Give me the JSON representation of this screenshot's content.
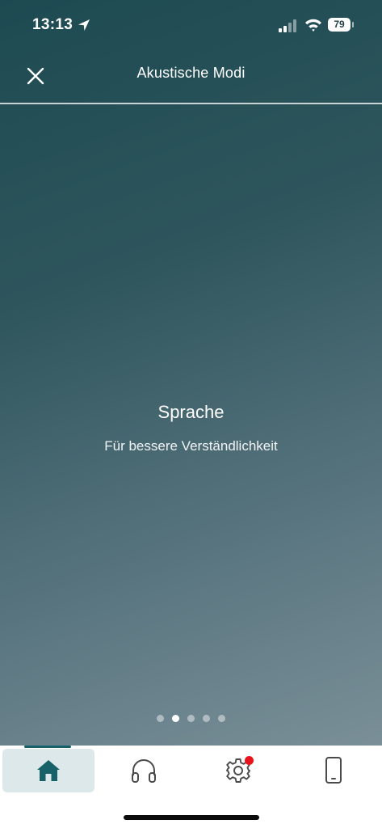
{
  "status_bar": {
    "time": "13:13",
    "battery": "79",
    "icons": [
      "location-arrow-icon",
      "cellular-signal-icon",
      "wifi-icon",
      "battery-icon"
    ]
  },
  "header": {
    "title": "Akustische Modi",
    "close_icon": "close-icon"
  },
  "mode": {
    "title": "Sprache",
    "subtitle": "Für bessere Verständlichkeit"
  },
  "pager": {
    "count": 5,
    "active_index": 1
  },
  "tab_bar": {
    "tabs": [
      {
        "icon": "home-icon",
        "active": true
      },
      {
        "icon": "headphones-icon",
        "active": false
      },
      {
        "icon": "gear-icon",
        "active": false,
        "notification": true
      },
      {
        "icon": "phone-icon",
        "active": false
      }
    ]
  },
  "colors": {
    "background_top": "#1d4a52",
    "background_bottom": "#7a8f98",
    "accent": "#17616b",
    "notification": "#e8141b"
  }
}
